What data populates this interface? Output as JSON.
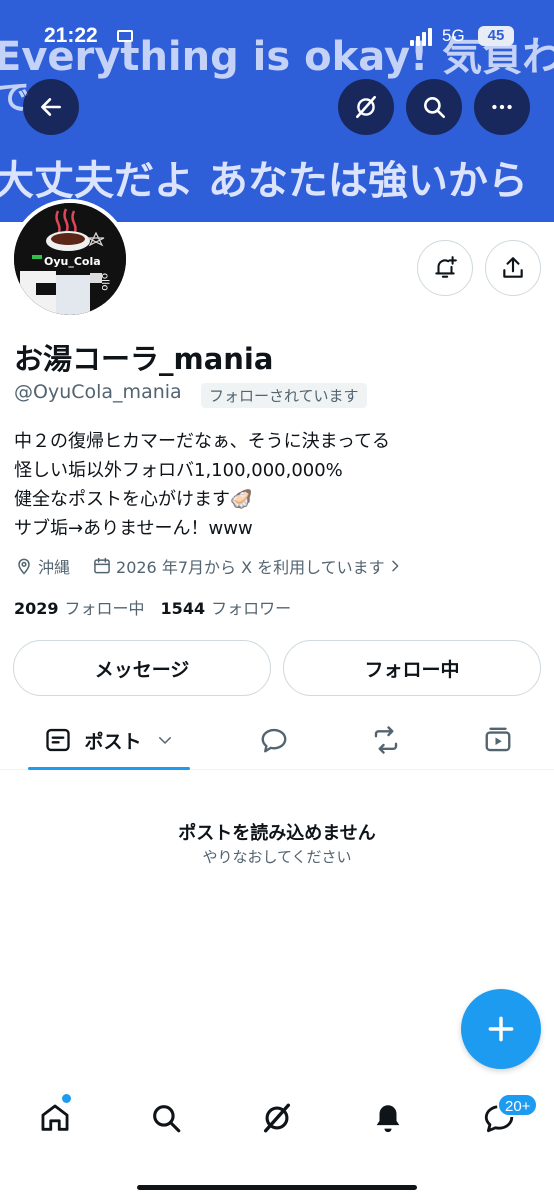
{
  "status_bar": {
    "time": "21:22",
    "network": "5G",
    "battery": "45"
  },
  "banner": {
    "line1": "Everything is okay! 気負わない",
    "line2": "で",
    "line3": "大丈夫だよ あなたは強いから"
  },
  "avatar": {
    "caption": "Oyu_Cola",
    "side_text": "ollo"
  },
  "profile": {
    "display_name": "お湯コーラ_mania",
    "handle": "@OyuCola_mania",
    "follows_you": "フォローされています",
    "bio_lines": [
      "中２の復帰ヒカマーだなぁ、そうに決まってる",
      "怪しい垢以外フォロバ1,100,000,000%",
      "健全なポストを心がけます🦪",
      "サブ垢→ありませーん！www"
    ],
    "location": "沖縄",
    "joined": "2026 年7月から X を利用しています",
    "following_count": "2029",
    "following_label": "フォロー中",
    "followers_count": "1544",
    "followers_label": "フォロワー"
  },
  "actions": {
    "message": "メッセージ",
    "following": "フォロー中"
  },
  "tabs": {
    "posts": "ポスト"
  },
  "empty_state": {
    "title": "ポストを読み込めません",
    "subtitle": "やりなおしてください"
  },
  "bottom_nav": {
    "messages_badge": "20+"
  },
  "colors": {
    "accent": "#1d9bf0",
    "banner": "#2f5fd8",
    "text": "#0f1419",
    "secondary": "#536471"
  },
  "icons": [
    "back-arrow-icon",
    "grok-icon",
    "search-icon",
    "more-icon",
    "bell-plus-icon",
    "share-icon",
    "location-pin-icon",
    "calendar-icon",
    "chevron-right-icon",
    "posts-icon",
    "chevron-down-icon",
    "reply-icon",
    "repost-icon",
    "media-icon",
    "plus-icon",
    "home-icon",
    "bell-icon",
    "messages-icon"
  ]
}
